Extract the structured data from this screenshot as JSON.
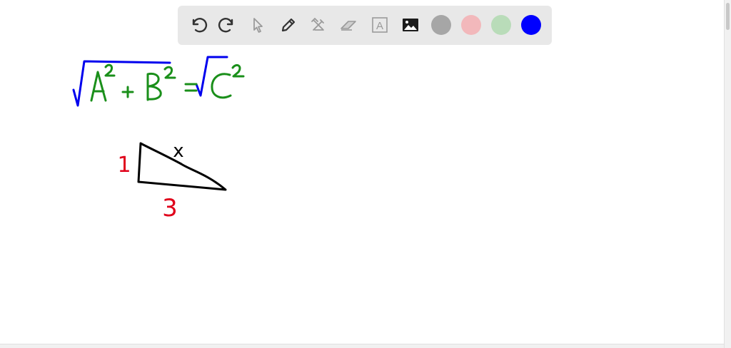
{
  "toolbar": {
    "tools": [
      {
        "icon": "undo-icon"
      },
      {
        "icon": "redo-icon"
      },
      {
        "icon": "select-cursor-icon"
      },
      {
        "icon": "pencil-icon"
      },
      {
        "icon": "tools-icon"
      },
      {
        "icon": "eraser-icon"
      },
      {
        "icon": "text-box-icon",
        "glyph": "A"
      },
      {
        "icon": "image-icon"
      }
    ],
    "colors": [
      "#a6a6a6",
      "#f2b8bb",
      "#b9dcb9",
      "#0000ff"
    ]
  },
  "canvas": {
    "equation": {
      "color": "#1a8f1a",
      "radical_color": "#0000ee"
    },
    "triangle": {
      "hypotenuse_label": "x",
      "left_side_label": "1",
      "bottom_side_label": "3",
      "label_color_hypotenuse": "#000000",
      "label_color_sides": "#e0001a"
    }
  }
}
